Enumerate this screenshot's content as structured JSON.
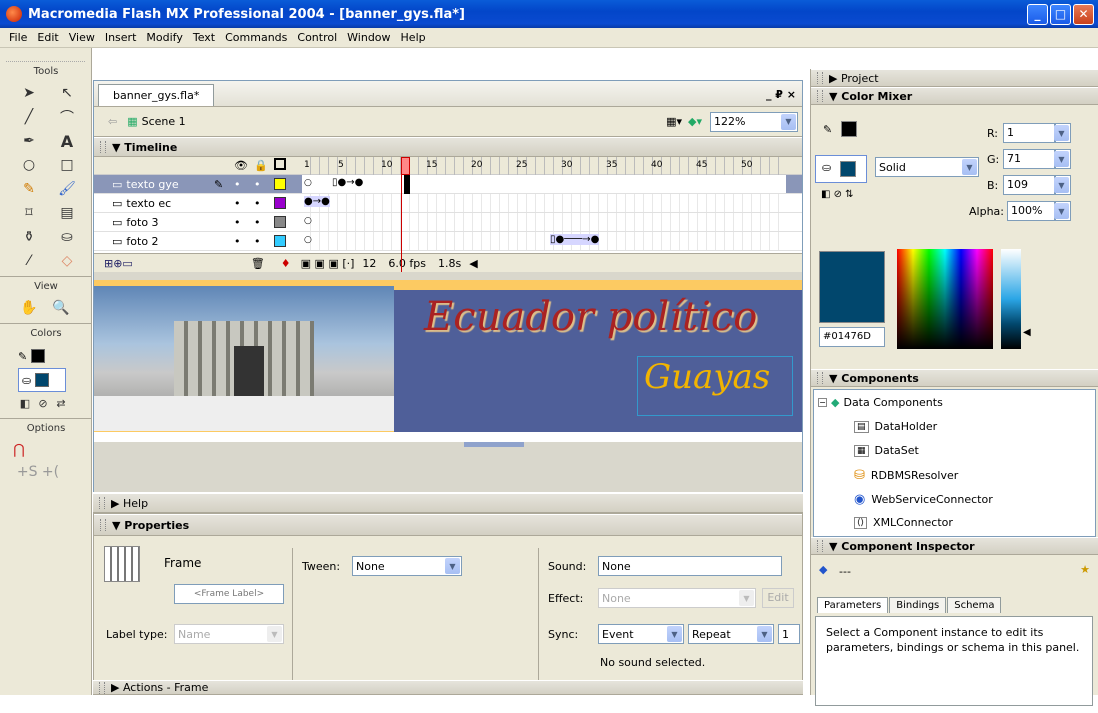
{
  "app": {
    "title": "Macromedia Flash MX Professional 2004 - [banner_gys.fla*]"
  },
  "menu": [
    "File",
    "Edit",
    "View",
    "Insert",
    "Modify",
    "Text",
    "Commands",
    "Control",
    "Window",
    "Help"
  ],
  "tools": {
    "header": "Tools",
    "view_label": "View",
    "colors_label": "Colors",
    "options_label": "Options"
  },
  "document": {
    "tab": "banner_gys.fla*",
    "scene": "Scene 1",
    "zoom": "122%",
    "window_controls": "_ ₽ ×"
  },
  "timeline": {
    "title": "Timeline",
    "ruler": [
      "1",
      "5",
      "10",
      "15",
      "20",
      "25",
      "30",
      "35",
      "40",
      "45",
      "50"
    ],
    "layers": [
      {
        "name": "texto gye",
        "color": "#ffff00",
        "selected": true
      },
      {
        "name": "texto ec",
        "color": "#9900cc",
        "selected": false
      },
      {
        "name": "foto 3",
        "color": "#808080",
        "selected": false
      },
      {
        "name": "foto 2",
        "color": "#33ccff",
        "selected": false
      }
    ],
    "frame": "12",
    "fps": "6.0 fps",
    "time": "1.8s"
  },
  "stage": {
    "title_text": "Ecuador político",
    "subtitle_text": "Guayas"
  },
  "help_label": "Help",
  "properties": {
    "title": "Properties",
    "frame_label": "Frame",
    "frame_label_placeholder": "<Frame Label>",
    "tween_label": "Tween:",
    "tween_value": "None",
    "label_type_label": "Label type:",
    "label_type_value": "Name",
    "sound_label": "Sound:",
    "sound_value": "None",
    "effect_label": "Effect:",
    "effect_value": "None",
    "edit_button": "Edit",
    "sync_label": "Sync:",
    "sync_value": "Event",
    "repeat_value": "Repeat",
    "repeat_count": "1",
    "status": "No sound selected."
  },
  "actions_label": "Actions - Frame",
  "project_label": "Project",
  "color_mixer": {
    "title": "Color Mixer",
    "r_label": "R:",
    "r": "1",
    "g_label": "G:",
    "g": "71",
    "b_label": "B:",
    "b": "109",
    "alpha_label": "Alpha:",
    "alpha": "100%",
    "fill_type": "Solid",
    "hex": "#01476D",
    "swatch": "#01476d"
  },
  "components": {
    "title": "Components",
    "group": "Data Components",
    "items": [
      "DataHolder",
      "DataSet",
      "RDBMSResolver",
      "WebServiceConnector",
      "XMLConnector"
    ]
  },
  "inspector": {
    "title": "Component Inspector",
    "name": "---",
    "tabs": [
      "Parameters",
      "Bindings",
      "Schema"
    ],
    "message": "Select a Component instance to edit its parameters, bindings or schema in this panel."
  }
}
